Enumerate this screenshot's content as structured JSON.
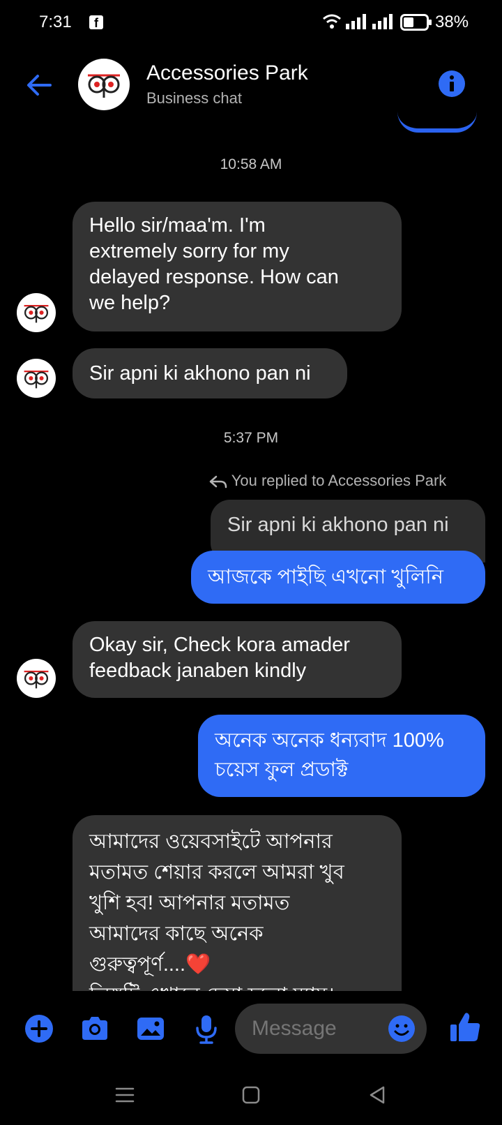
{
  "status_bar": {
    "time": "7:31",
    "battery": "38%",
    "fb_glyph": "f"
  },
  "header": {
    "title": "Accessories Park",
    "subtitle": "Business chat"
  },
  "conversation": {
    "timestamp_1": "10:58 AM",
    "msg_1": "Hello sir/maa'm. I'm\nextremely sorry for my\ndelayed response. How can\nwe help?",
    "msg_2": "Sir apni ki akhono pan ni",
    "timestamp_2": "5:37 PM",
    "reply_context": "You replied to Accessories Park",
    "quoted_text": "Sir apni ki akhono pan ni",
    "msg_3": "আজকে পাইছি এখনো খুলিনি",
    "msg_4": "Okay sir, Check kora amader\nfeedback janaben kindly",
    "msg_5": "অনেক অনেক ধন্যবাদ 100%\nচয়েস ফুল প্রডাক্ট",
    "msg_6": "আমাদের ওয়েবসাইটে আপনার\nমতামত শেয়ার করলে আমরা খুব\nখুশি হব! আপনার মতামত\nআমাদের কাছে অনেক\nগুরুত্বপূর্ণ....❤️\nলিঙ্কটি এখানে দেয়া হলো ম্যাম।"
  },
  "composer": {
    "placeholder": "Message"
  },
  "colors": {
    "accent": "#2f6bf5",
    "incoming": "#333333",
    "background": "#000000"
  },
  "icons": [
    "back-arrow-icon",
    "info-icon",
    "plus-icon",
    "camera-icon",
    "gallery-icon",
    "microphone-icon",
    "emoji-icon",
    "thumbs-up-icon",
    "menu-icon",
    "home-icon",
    "back-nav-icon"
  ]
}
